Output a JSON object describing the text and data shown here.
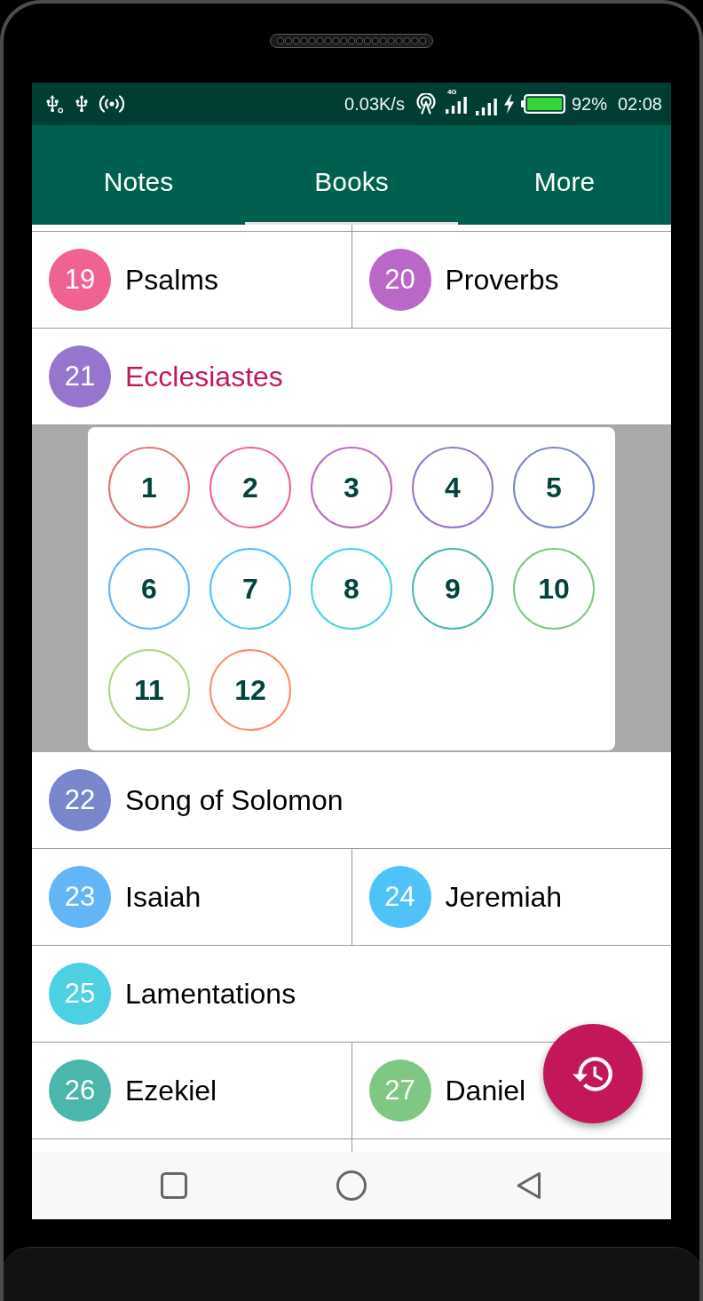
{
  "status_bar": {
    "network_speed": "0.03K/s",
    "network_type": "4G",
    "battery": "92%",
    "time": "02:08"
  },
  "tabs": [
    {
      "label": "Notes",
      "selected": false
    },
    {
      "label": "Books",
      "selected": true
    },
    {
      "label": "More",
      "selected": false
    }
  ],
  "book_rows": [
    {
      "books": [
        {
          "number": "19",
          "name": "Psalms",
          "color": "#f06292",
          "selected": false
        },
        {
          "number": "20",
          "name": "Proverbs",
          "color": "#ba68c8",
          "selected": false
        }
      ]
    },
    {
      "books": [
        {
          "number": "21",
          "name": "Ecclesiastes",
          "color": "#9575cd",
          "selected": true,
          "chapters": [
            {
              "number": "1",
              "color": "#e57373"
            },
            {
              "number": "2",
              "color": "#f06292"
            },
            {
              "number": "3",
              "color": "#ba68c8"
            },
            {
              "number": "4",
              "color": "#9575cd"
            },
            {
              "number": "5",
              "color": "#7986cb"
            },
            {
              "number": "6",
              "color": "#64b5f6"
            },
            {
              "number": "7",
              "color": "#4fc3f7"
            },
            {
              "number": "8",
              "color": "#4dd0e1"
            },
            {
              "number": "9",
              "color": "#4db6ac"
            },
            {
              "number": "10",
              "color": "#81c784"
            },
            {
              "number": "11",
              "color": "#aed581"
            },
            {
              "number": "12",
              "color": "#ff8a65"
            }
          ]
        }
      ]
    },
    {
      "books": [
        {
          "number": "22",
          "name": "Song of Solomon",
          "color": "#7986cb",
          "selected": false
        }
      ]
    },
    {
      "books": [
        {
          "number": "23",
          "name": "Isaiah",
          "color": "#64b5f6",
          "selected": false
        },
        {
          "number": "24",
          "name": "Jeremiah",
          "color": "#4fc3f7",
          "selected": false
        }
      ]
    },
    {
      "books": [
        {
          "number": "25",
          "name": "Lamentations",
          "color": "#4dd0e1",
          "selected": false
        }
      ]
    },
    {
      "books": [
        {
          "number": "26",
          "name": "Ezekiel",
          "color": "#4db6ac",
          "selected": false
        },
        {
          "number": "27",
          "name": "Daniel",
          "color": "#81c784",
          "selected": false
        }
      ]
    }
  ]
}
